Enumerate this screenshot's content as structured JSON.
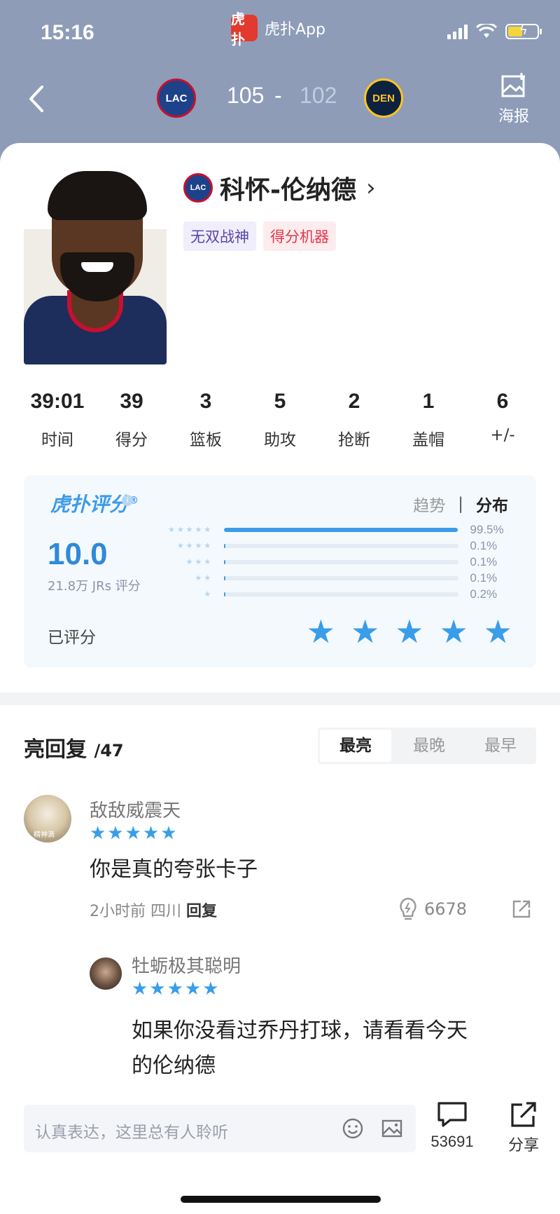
{
  "status_bar": {
    "time": "15:16",
    "app_name": "虎扑App",
    "app_logo_text": "虎扑"
  },
  "header": {
    "home_team": "LAC",
    "away_team": "DEN",
    "home_score": "105",
    "separator": "-",
    "away_score": "102",
    "poster_label": "海报"
  },
  "player": {
    "team_abbr": "LAC",
    "name": "科怀-伦纳德",
    "tags": [
      "无双战神",
      "得分机器"
    ]
  },
  "stats": [
    {
      "value": "39:01",
      "label": "时间"
    },
    {
      "value": "39",
      "label": "得分"
    },
    {
      "value": "3",
      "label": "篮板"
    },
    {
      "value": "5",
      "label": "助攻"
    },
    {
      "value": "2",
      "label": "抢断"
    },
    {
      "value": "1",
      "label": "盖帽"
    },
    {
      "value": "6",
      "label": "+/-"
    }
  ],
  "rating": {
    "logo": "虎扑评分",
    "reg": "®",
    "tabs": [
      "趋势",
      "分布"
    ],
    "tab_sep": "|",
    "active_tab": "分布",
    "score": "10.0",
    "count_text": "21.8万 JRs 评分",
    "distribution": [
      {
        "stars": 5,
        "pct": "99.5%",
        "value": 99.5
      },
      {
        "stars": 4,
        "pct": "0.1%",
        "value": 0.1
      },
      {
        "stars": 3,
        "pct": "0.1%",
        "value": 0.1
      },
      {
        "stars": 2,
        "pct": "0.1%",
        "value": 0.1
      },
      {
        "stars": 1,
        "pct": "0.2%",
        "value": 0.2
      }
    ],
    "rated_label": "已评分",
    "user_rating": 5
  },
  "replies": {
    "title": "亮回复",
    "count": "/47",
    "sort_tabs": [
      "最亮",
      "最晚",
      "最早"
    ],
    "active_sort": "最亮"
  },
  "comments": [
    {
      "user": "敌敌威震天",
      "avatar_caption": "精神滴",
      "stars": "★★★★★",
      "text": "你是真的夸张卡子",
      "time": "2小时前",
      "location": "四川",
      "reply_label": "回复",
      "likes": "6678"
    },
    {
      "user": "牡蛎极其聪明",
      "stars": "★★★★★",
      "text_line1": "如果你没看过乔丹打球，请看看今天",
      "text_line2": "的伦纳德"
    }
  ],
  "bottom": {
    "input_placeholder": "认真表达，这里总有人聆听",
    "comments_count": "53691",
    "share_label": "分享"
  },
  "colors": {
    "header_bg": "#8e9cb8",
    "accent_blue": "#3a9de8",
    "tag_red": "#e2384d",
    "tag_purple": "#5b45a8"
  }
}
